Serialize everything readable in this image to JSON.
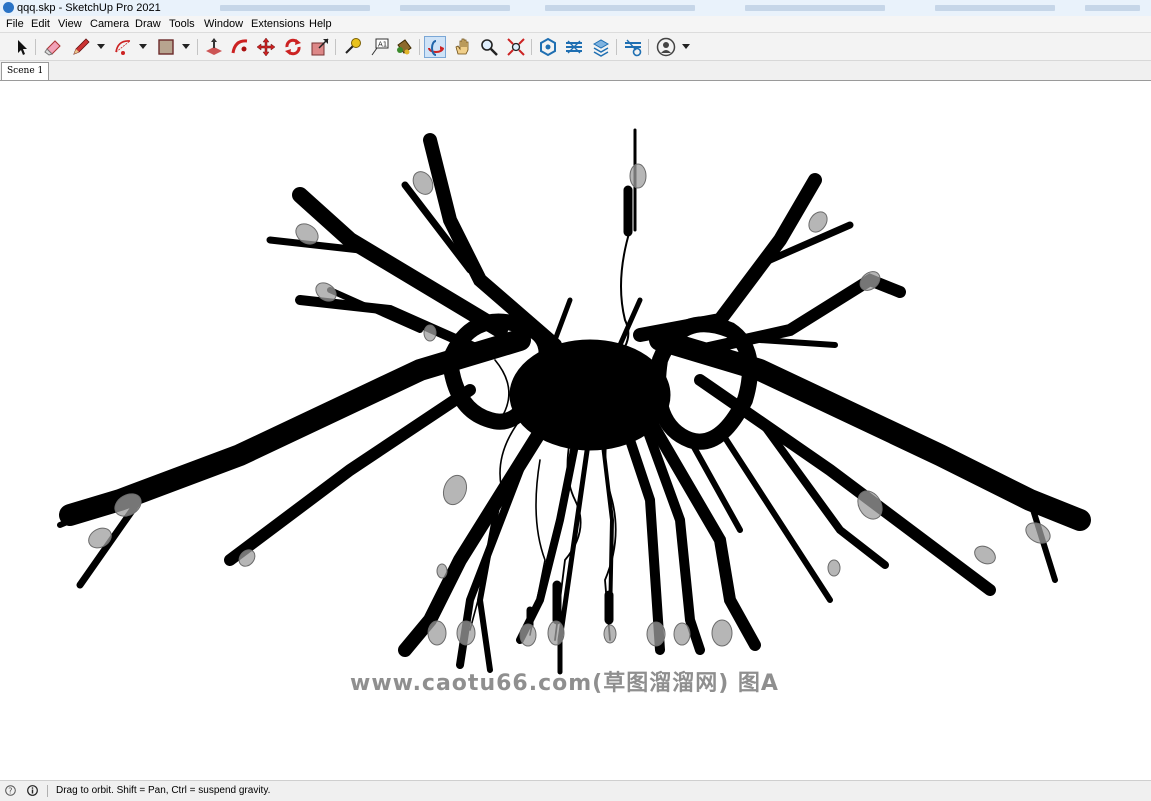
{
  "window": {
    "title": "qqq.skp - SketchUp Pro 2021"
  },
  "menu": [
    "File",
    "Edit",
    "View",
    "Camera",
    "Draw",
    "Tools",
    "Window",
    "Extensions",
    "Help"
  ],
  "toolbar": {
    "tools": [
      "select-icon",
      "eraser-icon",
      "pencil-line-icon",
      "arc-icon",
      "rectangle-icon",
      "push-pull-icon",
      "follow-me-icon",
      "move-icon",
      "rotate-icon",
      "scale-icon",
      "tape-measure-icon",
      "text-icon",
      "paint-bucket-icon",
      "orbit-icon",
      "pan-icon",
      "zoom-icon",
      "zoom-extents-icon",
      "3d-warehouse-icon",
      "extension-warehouse-icon",
      "layout-icon",
      "extension-manager-icon",
      "account-icon"
    ],
    "active_tool": "orbit-icon"
  },
  "scenes": {
    "tabs": [
      "Scene 1"
    ]
  },
  "viewport": {
    "model": "branch-chandelier",
    "watermark": "www.caotu66.com(草图溜溜网) 图A"
  },
  "status": {
    "text": "Drag to orbit. Shift = Pan, Ctrl = suspend gravity."
  },
  "colors": {
    "model": "#000000",
    "bulb": "#9a9a9a",
    "accent": "#2a73c5"
  }
}
